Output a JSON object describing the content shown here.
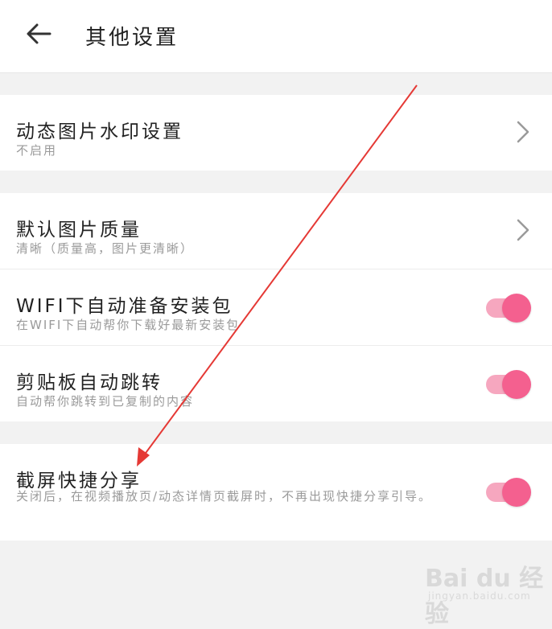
{
  "header": {
    "back_icon": "arrow-left-icon",
    "title": "其他设置"
  },
  "groups": [
    {
      "items": [
        {
          "label": "动态图片水印设置",
          "sub": "不启用",
          "control": "chevron"
        }
      ]
    },
    {
      "items": [
        {
          "label": "默认图片质量",
          "sub": "清晰（质量高，图片更清晰）",
          "control": "chevron"
        },
        {
          "label": "WIFI下自动准备安装包",
          "sub": "在WIFI下自动帮你下载好最新安装包",
          "control": "toggle",
          "on": true
        },
        {
          "label": "剪贴板自动跳转",
          "sub": "自动帮你跳转到已复制的内容",
          "control": "toggle",
          "on": true
        }
      ]
    },
    {
      "items": [
        {
          "label": "截屏快捷分享",
          "sub": "关闭后，在视频播放页/动态详情页截屏时，不再出现快捷分享引导。",
          "control": "toggle",
          "on": true
        }
      ]
    }
  ],
  "colors": {
    "toggle_on_knob": "#f4608f",
    "toggle_on_track": "#f6a7bf",
    "annotation_arrow": "#e53935"
  },
  "watermark": {
    "text": "Bai du 经验",
    "url": "jingyan.baidu.com"
  }
}
